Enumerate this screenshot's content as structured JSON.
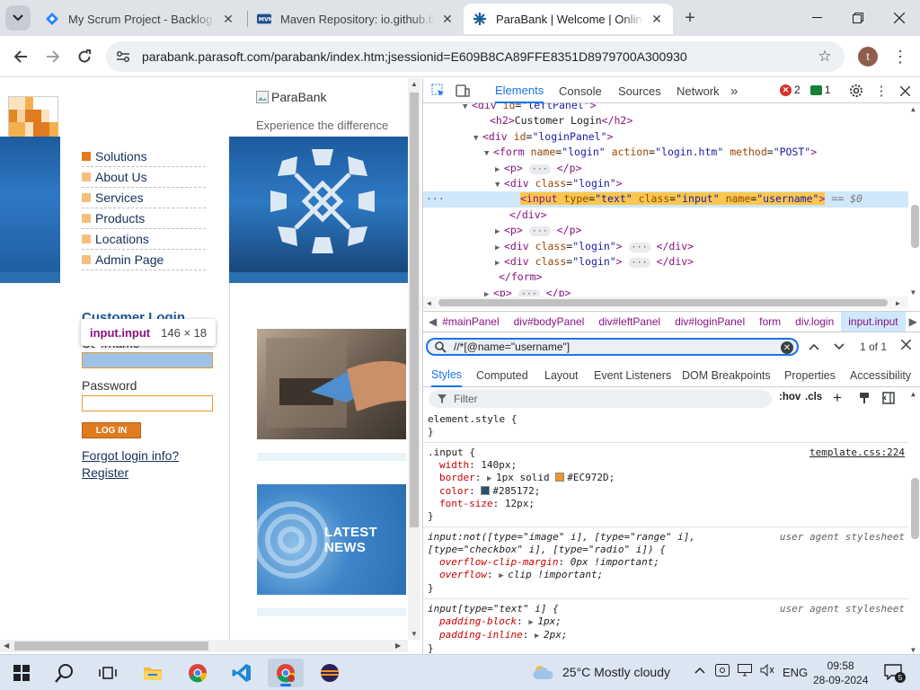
{
  "browser": {
    "tabs": [
      {
        "title": "My Scrum Project - Backlog - Jira",
        "icon": "jira-icon"
      },
      {
        "title": "Maven Repository: io.github.bonigarcia",
        "icon": "maven-icon"
      },
      {
        "title": "ParaBank | Welcome | Online Banking",
        "icon": "parasoft-icon",
        "active": true
      }
    ],
    "url": "parabank.parasoft.com/parabank/index.htm;jsessionid=E609B8CA89FFE8351D8979700A300930",
    "profile_initial": "t"
  },
  "page": {
    "brand_alt": "ParaBank",
    "caption": "Experience the difference",
    "nav": [
      "Solutions",
      "About Us",
      "Services",
      "Products",
      "Locations",
      "Admin Page"
    ],
    "login_title": "Customer Login",
    "username_label": "Username",
    "password_label": "Password",
    "login_button": "LOG IN",
    "forgot_link": "Forgot login info?",
    "register_link": "Register",
    "news_line1": "LATEST",
    "news_line2": "NEWS",
    "tooltip": {
      "tag": "input.input",
      "dims": "146 × 18"
    }
  },
  "devtools": {
    "tabs": [
      "Elements",
      "Console",
      "Sources",
      "Network"
    ],
    "more": "»",
    "errors": "2",
    "messages": "1",
    "dom": [
      {
        "html": "<span class=\"tg\">&lt;div</span> <span class=\"an\">id</span>=<span class=\"av\">\"leftPanel\"</span><span class=\"tg\">&gt;</span>"
      },
      {
        "html": "<span class=\"tg\">&lt;h2&gt;</span><span class=\"tx\">Customer Login</span><span class=\"tg\">&lt;/h2&gt;</span>"
      },
      {
        "html": "<span class=\"tg\">&lt;div</span> <span class=\"an\">id</span>=<span class=\"av\">\"loginPanel\"</span><span class=\"tg\">&gt;</span>"
      },
      {
        "html": "<span class=\"tg\">&lt;form</span> <span class=\"an\">name</span>=<span class=\"av\">\"login\"</span> <span class=\"an\">action</span>=<span class=\"av\">\"login.htm\"</span> <span class=\"an\">method</span>=<span class=\"av\">\"POST\"</span><span class=\"tg\">&gt;</span>"
      },
      {
        "html": "<span class=\"tg\">&lt;p&gt;</span> <span class=\"ell\">···</span> <span class=\"tg\">&lt;/p&gt;</span>"
      },
      {
        "html": "<span class=\"tg\">&lt;div</span> <span class=\"an\">class</span>=<span class=\"av\">\"login\"</span><span class=\"tg\">&gt;</span>"
      },
      {
        "html": "<span class=\"hl\"><span class=\"tg\">&lt;input</span> <span class=\"an\">type</span>=<span class=\"av\">\"text\"</span> <span class=\"an\">class</span>=<span class=\"av\">\"input\"</span> <span class=\"an\">name</span>=<span class=\"av\">\"username\"</span><span class=\"tg\">&gt;</span></span> <span class=\"eq\">== $0</span>"
      },
      {
        "html": "<span class=\"tg\">&lt;/div&gt;</span>"
      },
      {
        "html": "<span class=\"tg\">&lt;p&gt;</span> <span class=\"ell\">···</span> <span class=\"tg\">&lt;/p&gt;</span>"
      },
      {
        "html": "<span class=\"tg\">&lt;div</span> <span class=\"an\">class</span>=<span class=\"av\">\"login\"</span><span class=\"tg\">&gt;</span> <span class=\"ell\">···</span> <span class=\"tg\">&lt;/div&gt;</span>"
      },
      {
        "html": "<span class=\"tg\">&lt;div</span> <span class=\"an\">class</span>=<span class=\"av\">\"login\"</span><span class=\"tg\">&gt;</span> <span class=\"ell\">···</span> <span class=\"tg\">&lt;/div&gt;</span>"
      },
      {
        "html": "<span class=\"tg\">&lt;/form&gt;</span>"
      },
      {
        "html": "<span class=\"tg\">&lt;p&gt;</span> <span class=\"ell\">···</span> <span class=\"tg\">&lt;/p&gt;</span>"
      }
    ],
    "breadcrumbs": [
      "#mainPanel",
      "div#bodyPanel",
      "div#leftPanel",
      "div#loginPanel",
      "form",
      "div.login",
      "input.input"
    ],
    "search_query": "//*[@name=\"username\"]",
    "search_count": "1 of 1",
    "styles_tabs": [
      "Styles",
      "Computed",
      "Layout",
      "Event Listeners",
      "DOM Breakpoints",
      "Properties",
      "Accessibility"
    ],
    "filter_placeholder": "Filter",
    "hov": ":hov",
    "cls": ".cls",
    "rules": {
      "element_style": "element.style {",
      "close": "}",
      "input_sel": ".input {",
      "input_src": "template.css:224",
      "width": "140px;",
      "border_a": "1px solid",
      "border_color": "#EC972D;",
      "color_val": "#285172;",
      "font_size": "12px;",
      "ua1_sel_a": "input:not([type=\"image\" i], [type=\"range\" i],",
      "ua1_sel_b": "[type=\"checkbox\" i], [type=\"radio\" i]) {",
      "ua_src": "user agent stylesheet",
      "ocm": "0px !important;",
      "overflow": "clip !important;",
      "ua2_sel": "input[type=\"text\" i] {",
      "pb": "1px;",
      "pi": "2px;"
    },
    "colors": {
      "border": "#EC972D",
      "text": "#285172"
    }
  },
  "taskbar": {
    "weather": "25°C  Mostly cloudy",
    "lang": "ENG",
    "time": "09:58",
    "date": "28-09-2024",
    "notifications": "5"
  }
}
